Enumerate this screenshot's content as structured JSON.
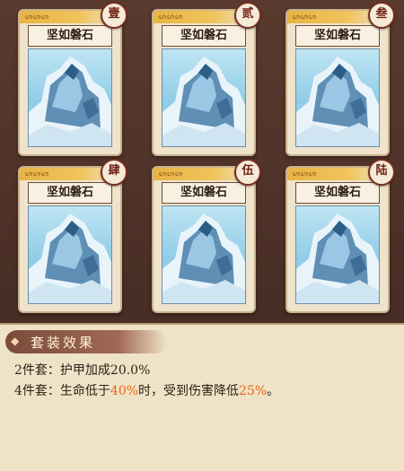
{
  "cards": [
    {
      "name": "坚如磐石",
      "index": "壹"
    },
    {
      "name": "坚如磐石",
      "index": "贰"
    },
    {
      "name": "坚如磐石",
      "index": "叁"
    },
    {
      "name": "坚如磐石",
      "index": "肆"
    },
    {
      "name": "坚如磐石",
      "index": "伍"
    },
    {
      "name": "坚如磐石",
      "index": "陆"
    }
  ],
  "bonus": {
    "title": "套装效果",
    "line1": {
      "label": "2件套：",
      "text": "护甲加成20.0%"
    },
    "line2": {
      "label": "4件套：",
      "pre": "生命低于",
      "v1": "40%",
      "mid": "时，受到伤害降低",
      "v2": "25%",
      "post": "。"
    }
  },
  "colors": {
    "highlight": "#e8651a",
    "badge_border": "#7a2f1e",
    "card_bg": "#efe3cc"
  }
}
